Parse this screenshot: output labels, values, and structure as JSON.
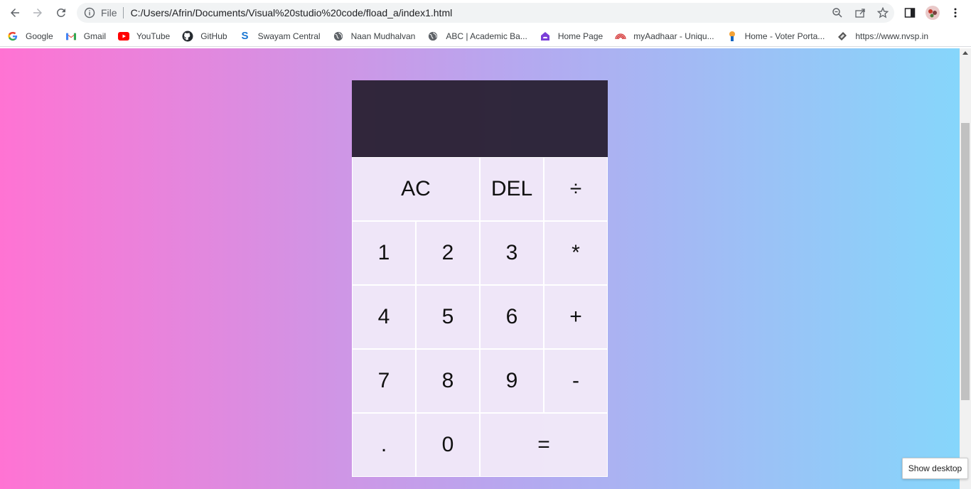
{
  "browser": {
    "scheme_label": "File",
    "url": "C:/Users/Afrin/Documents/Visual%20studio%20code/fload_a/index1.html"
  },
  "bookmarks": [
    {
      "label": "Google",
      "icon": "google-icon"
    },
    {
      "label": "Gmail",
      "icon": "gmail-icon"
    },
    {
      "label": "YouTube",
      "icon": "youtube-icon"
    },
    {
      "label": "GitHub",
      "icon": "github-icon"
    },
    {
      "label": "Swayam Central",
      "icon": "swayam-icon"
    },
    {
      "label": "Naan Mudhalvan",
      "icon": "globe-icon"
    },
    {
      "label": "ABC | Academic Ba...",
      "icon": "globe-icon"
    },
    {
      "label": "Home Page",
      "icon": "home-page-icon"
    },
    {
      "label": "myAadhaar - Uniqu...",
      "icon": "aadhaar-icon"
    },
    {
      "label": "Home - Voter Porta...",
      "icon": "voter-portal-icon"
    },
    {
      "label": "https://www.nvsp.in",
      "icon": "nvsp-icon"
    }
  ],
  "calculator": {
    "display": {
      "previous": "",
      "current": ""
    },
    "keys": {
      "ac": "AC",
      "del": "DEL",
      "divide": "÷",
      "one": "1",
      "two": "2",
      "three": "3",
      "multiply": "*",
      "four": "4",
      "five": "5",
      "six": "6",
      "plus": "+",
      "seven": "7",
      "eight": "8",
      "nine": "9",
      "minus": "-",
      "dot": ".",
      "zero": "0",
      "equals": "="
    }
  },
  "tooltip": {
    "show_desktop": "Show desktop"
  },
  "colors": {
    "gradient_start": "#ff73d3",
    "gradient_end": "#86d6fb",
    "display_bg": "#2e2538",
    "key_bg": "#f0e8f8"
  }
}
